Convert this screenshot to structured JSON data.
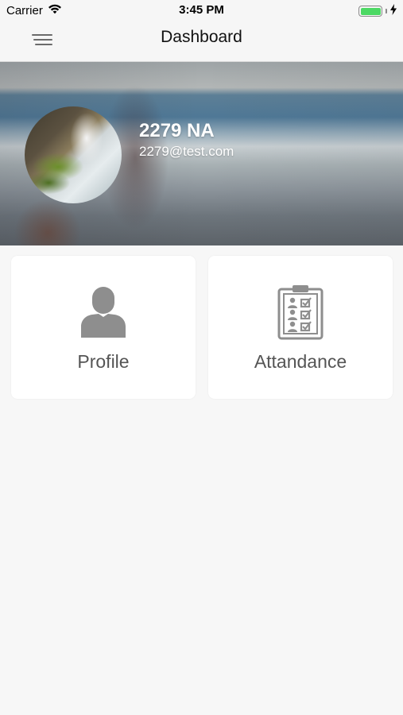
{
  "status_bar": {
    "carrier": "Carrier",
    "time": "3:45 PM",
    "battery_level": 1.0
  },
  "nav": {
    "title": "Dashboard",
    "menu_icon": "hamburger-menu-icon"
  },
  "profile": {
    "name": "2279 NA",
    "email": "2279@test.com"
  },
  "cards": [
    {
      "label": "Profile",
      "icon": "person-icon"
    },
    {
      "label": "Attandance",
      "icon": "attendance-clipboard-icon"
    }
  ],
  "colors": {
    "background": "#f7f7f7",
    "card": "#ffffff",
    "icon_gray": "#8e8e8e",
    "battery_green": "#4cd964"
  }
}
